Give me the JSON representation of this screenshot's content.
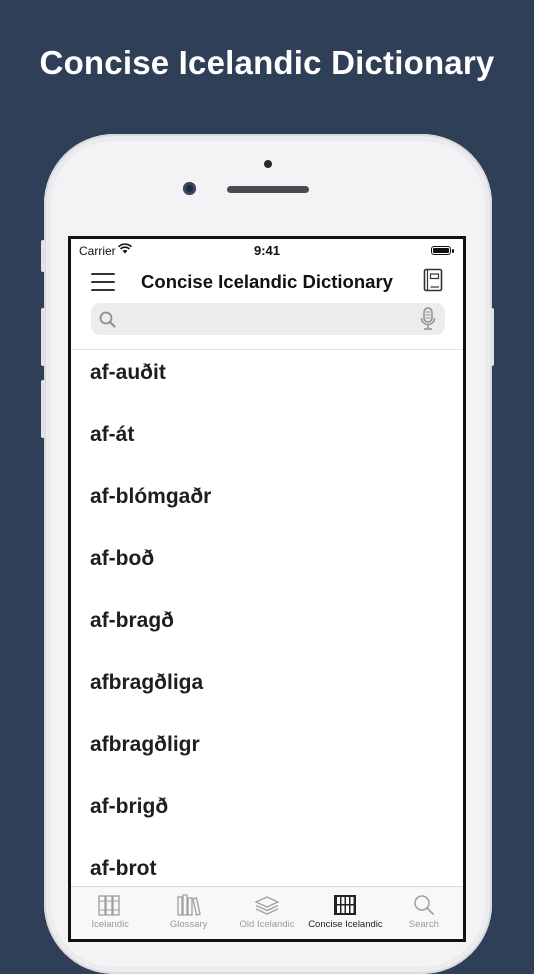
{
  "headline": "Concise Icelandic Dictionary",
  "status": {
    "carrier": "Carrier",
    "time": "9:41"
  },
  "navbar": {
    "title": "Concise Icelandic Dictionary"
  },
  "search": {
    "value": "",
    "placeholder": ""
  },
  "words": [
    "af-auðit",
    "af-át",
    "af-blómgaðr",
    "af-boð",
    "af-bragð",
    "afbragðliga",
    "afbragðligr",
    "af-brigð",
    "af-brot"
  ],
  "tabs": [
    {
      "label": "Icelandic",
      "icon": "books-icon",
      "active": false
    },
    {
      "label": "Glossary",
      "icon": "book-shelf-icon",
      "active": false
    },
    {
      "label": "Old Icelandic",
      "icon": "layers-icon",
      "active": false
    },
    {
      "label": "Concise Icelandic",
      "icon": "dictionary-shelf-icon",
      "active": true
    },
    {
      "label": "Search",
      "icon": "search-icon",
      "active": false
    }
  ],
  "colors": {
    "background": "#2f3f57",
    "active_tab": "#222222",
    "inactive_tab": "#9a9a9a"
  }
}
